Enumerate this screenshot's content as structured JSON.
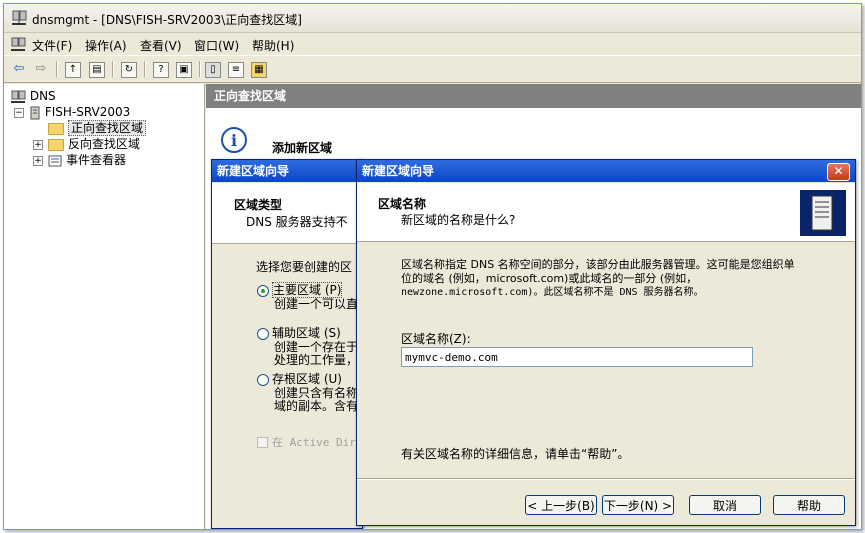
{
  "window": {
    "title": "dnsmgmt - [DNS\\FISH-SRV2003\\正向查找区域]"
  },
  "menu": [
    "文件(F)",
    "操作(A)",
    "查看(V)",
    "窗口(W)",
    "帮助(H)"
  ],
  "tree": {
    "root": "DNS",
    "server": "FISH-SRV2003",
    "items": [
      "正向查找区域",
      "反向查找区域",
      "事件查看器"
    ]
  },
  "right_pane": {
    "header": "正向查找区域",
    "info_title": "添加新区域"
  },
  "wizard_back": {
    "title": "新建区域向导",
    "head_title": "区域类型",
    "head_sub": "DNS 服务器支持不",
    "prompt": "选择您要创建的区",
    "options": [
      {
        "label": "主要区域 (P)",
        "desc1": "创建一个可以直",
        "desc2": ""
      },
      {
        "label": "辅助区域 (S)",
        "desc1": "创建一个存在于",
        "desc2": "处理的工作量，"
      },
      {
        "label": "存根区域 (U)",
        "desc1": "创建只含有名称",
        "desc2": "域的副本。含有"
      }
    ],
    "checkbox_label": "在 Active Dire"
  },
  "wizard_front": {
    "title": "新建区域向导",
    "head_title": "区域名称",
    "head_sub": "新区域的名称是什么?",
    "desc_line1": "区域名称指定 DNS 名称空间的部分，该部分由此服务器管理。这可能是您组织单",
    "desc_line2": "位的域名 (例如，microsoft.com)或此域名的一部分 (例如，",
    "desc_line3": "newzone.microsoft.com)。此区域名称不是 DNS 服务器名称。",
    "field_label": "区域名称(Z):",
    "field_value": "mymvc-demo.com",
    "help_text": "有关区域名称的详细信息，请单击“帮助”。",
    "buttons": {
      "back": "< 上一步(B)",
      "next": "下一步(N) >",
      "cancel": "取消",
      "help": "帮助"
    }
  }
}
